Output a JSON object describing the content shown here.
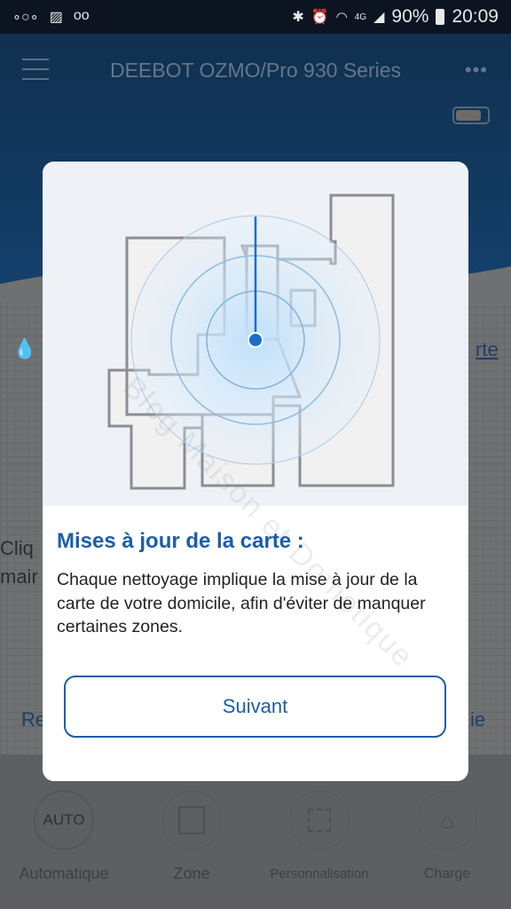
{
  "status_bar": {
    "left_icons": [
      "voicemail-dots-icon",
      "image-icon",
      "voicemail-icon"
    ],
    "right_icons": [
      "bluetooth-icon",
      "alarm-icon",
      "wifi-icon",
      "4g-icon",
      "signal-icon"
    ],
    "battery": "90%",
    "time": "20:09"
  },
  "header": {
    "title": "DEEBOT OZMO/Pro 930 Series",
    "menu_icon": "hamburger-icon",
    "more_icon": "more-dots-icon",
    "battery_icon": "battery-icon"
  },
  "background": {
    "fragment_carte": "rte",
    "fragment_cliq": "Cliq",
    "fragment_main": "mair",
    "fragment_re": "Re",
    "fragment_ie": "ie"
  },
  "modes": [
    {
      "label": "Automatique",
      "icon_text": "AUTO"
    },
    {
      "label": "Zone",
      "icon": "zone-icon"
    },
    {
      "label": "Personnalisation",
      "icon": "custom-area-icon"
    },
    {
      "label": "Charge",
      "icon": "charge-home-icon"
    }
  ],
  "dialog": {
    "title": "Mises à jour de la carte :",
    "body": "Chaque nettoyage implique la mise à jour de la carte de votre domicile, afin d'éviter de manquer certaines zones.",
    "button": "Suivant",
    "watermark": "Blog Maison et Domotique"
  },
  "colors": {
    "accent": "#1b5ea8",
    "header": "#10304f"
  }
}
